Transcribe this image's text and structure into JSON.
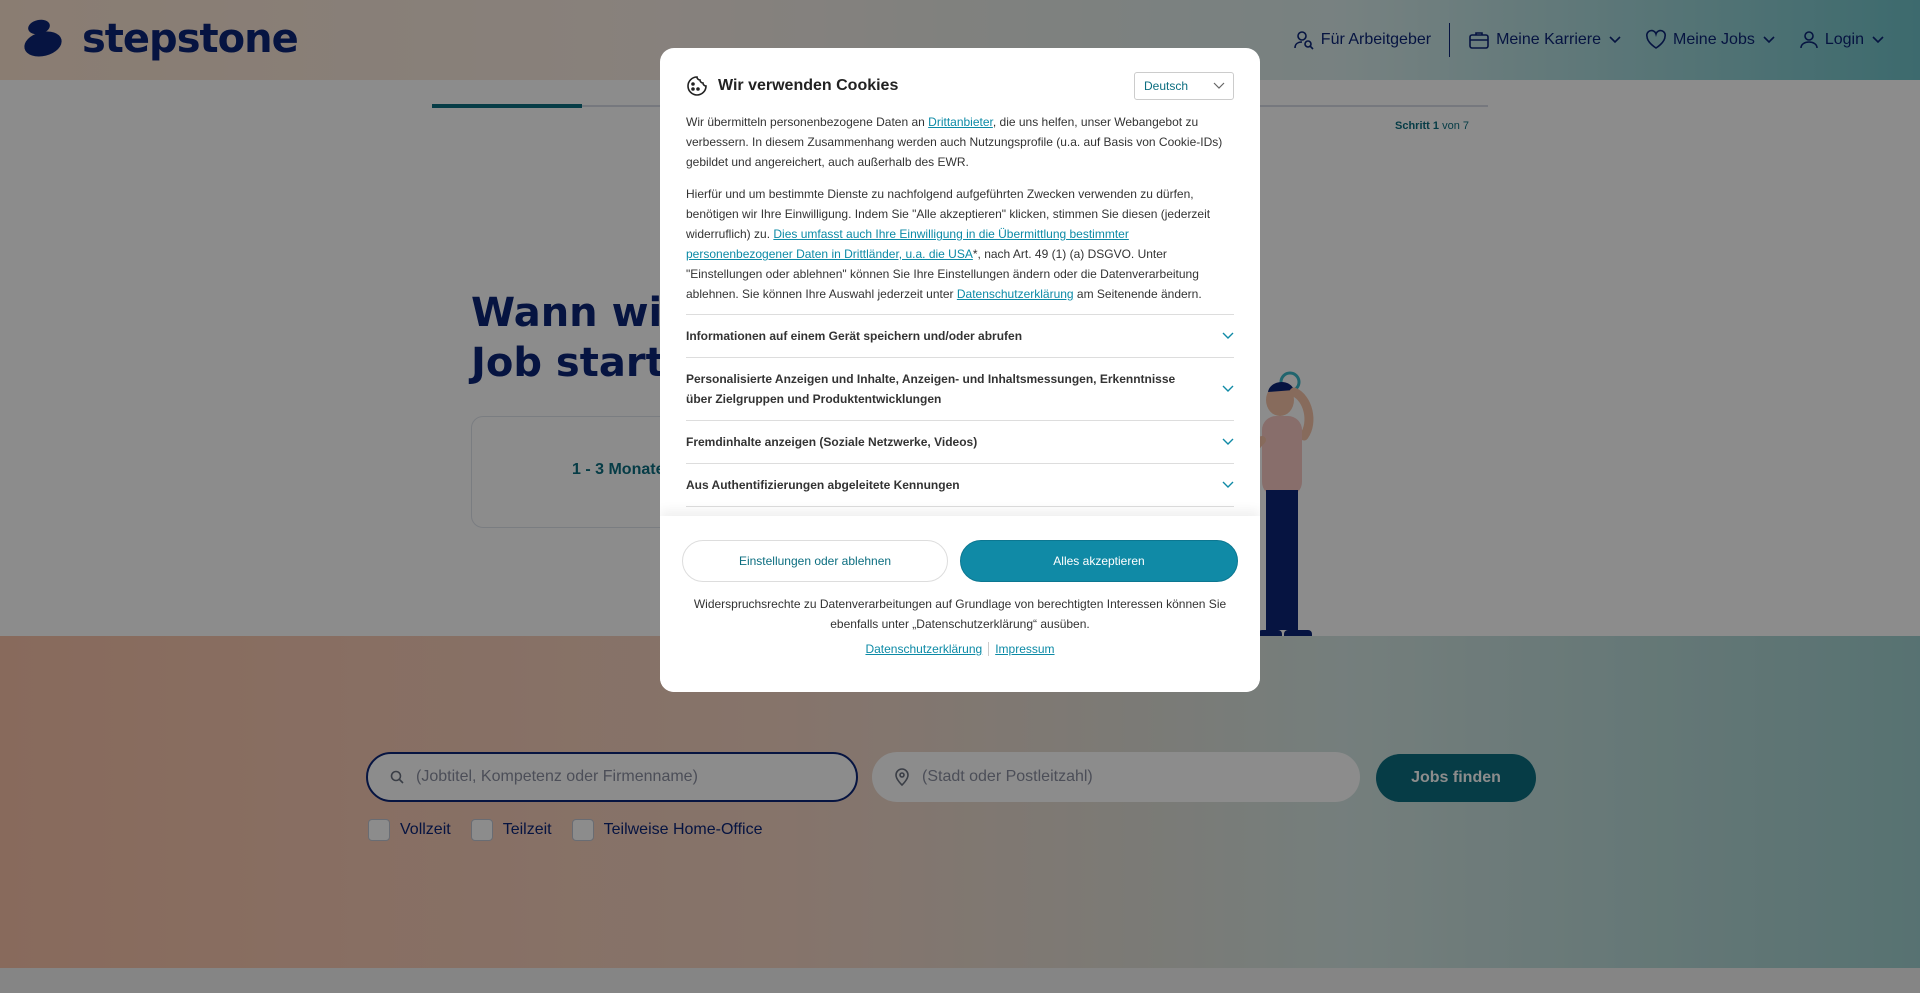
{
  "brand": {
    "name": "stepstone"
  },
  "nav": {
    "employers": "Für Arbeitgeber",
    "career": "Meine Karriere",
    "jobs": "Meine Jobs",
    "login": "Login"
  },
  "wizard": {
    "step_word": "Schritt",
    "step_current": "1",
    "step_of": "von 7",
    "progress": 0.14,
    "title": "Wann willst du deinen neuen Job starten?",
    "title_visible": "Wann wills\nJob starte",
    "first_option": "1 - 3 Monate"
  },
  "search": {
    "job_placeholder": "(Jobtitel, Kompetenz oder Firmenname)",
    "location_placeholder": "(Stadt oder Postleitzahl)",
    "submit_label": "Jobs finden",
    "filters": [
      "Vollzeit",
      "Teilzeit",
      "Teilweise Home-Office"
    ]
  },
  "cookie_modal": {
    "title": "Wir verwenden Cookies",
    "language": "Deutsch",
    "para1_a": "Wir übermitteln personenbezogene Daten an ",
    "para1_link": "Drittanbieter",
    "para1_b": ", die uns helfen, unser Webangebot zu verbessern. In diesem Zusammenhang werden auch Nutzungsprofile (u.a. auf Basis von Cookie-IDs) gebildet und angereichert, auch außerhalb des EWR.",
    "para2_a": "Hierfür und um bestimmte Dienste zu nachfolgend aufgeführten Zwecken verwenden zu dürfen, benötigen wir Ihre Einwilligung. Indem Sie \"Alle akzeptieren\" klicken, stimmen Sie diesen (jederzeit widerruflich) zu. ",
    "para2_link": "Dies umfasst auch Ihre Einwilligung in die Übermittlung bestimmter personenbezogener Daten in Drittländer, u.a. die USA",
    "para2_b": "*, nach Art. 49 (1) (a) DSGVO. Unter \"Einstellungen oder ablehnen\" können Sie Ihre Einstellungen ändern oder die Datenverarbeitung ablehnen. Sie können Ihre Auswahl jederzeit unter ",
    "para2_link2": "Datenschutzerklärung",
    "para2_c": " am Seitenende ändern.",
    "purposes": [
      "Informationen auf einem Gerät speichern und/oder abrufen",
      "Personalisierte Anzeigen und Inhalte, Anzeigen- und Inhaltsmessungen, Erkenntnisse über Zielgruppen und Produktentwicklungen",
      "Fremdinhalte anzeigen (Soziale Netzwerke, Videos)",
      "Aus Authentifizierungen abgeleitete Kennungen"
    ],
    "settings_button": "Einstellungen oder ablehnen",
    "accept_button": "Alles akzeptieren",
    "objection_note": "Widerspruchsrechte zu Datenverarbeitungen auf Grundlage von berechtigten Interessen können Sie ebenfalls unter „Datenschutzerklärung“ ausüben.",
    "privacy_link": "Datenschutzerklärung",
    "imprint_link": "Impressum"
  },
  "colors": {
    "brand_navy": "#0c2577",
    "teal": "#0c6e80",
    "accept_blue": "#108aa6"
  }
}
